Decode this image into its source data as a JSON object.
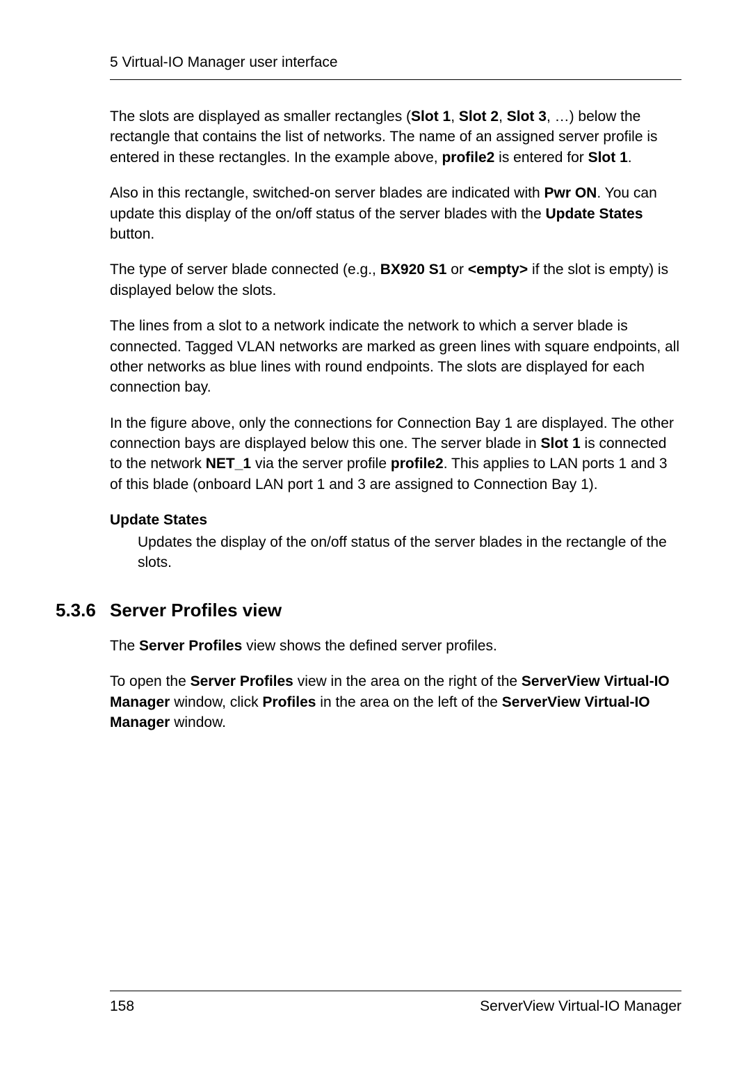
{
  "header": {
    "title": "5 Virtual-IO Manager user interface"
  },
  "content": {
    "p1_a": "The slots are displayed as smaller rectangles (",
    "p1_b": "Slot 1",
    "p1_c": ", ",
    "p1_d": "Slot 2",
    "p1_e": ", ",
    "p1_f": "Slot 3",
    "p1_g": ", …) below the rectangle that contains the list of networks. The name of an assigned server profile is entered in these rectangles. In the example above, ",
    "p1_h": "profile2",
    "p1_i": " is entered for ",
    "p1_j": "Slot 1",
    "p1_k": ".",
    "p2_a": "Also in this rectangle, switched-on server blades are indicated with ",
    "p2_b": "Pwr ON",
    "p2_c": ". You can update this display of the on/off status of the server blades with the ",
    "p2_d": "Update States",
    "p2_e": " button.",
    "p3_a": "The type of server blade connected (e.g., ",
    "p3_b": "BX920 S1",
    "p3_c": "  or ",
    "p3_d": "<empty>",
    "p3_e": " if the slot is empty) is displayed below the slots.",
    "p4": "The lines from a slot to a network indicate the network to which a server blade is connected. Tagged VLAN networks are marked as green lines with square endpoints, all other networks as blue lines with round endpoints. The slots are displayed for each connection bay.",
    "p5_a": "In the figure above, only the connections for Connection Bay 1 are displayed. The other connection bays are displayed below this one. The server blade in ",
    "p5_b": "Slot 1",
    "p5_c": " is connected to the network ",
    "p5_d": "NET_1",
    "p5_e": " via the server profile ",
    "p5_f": "profile2",
    "p5_g": ". This applies to LAN ports 1 and 3 of this blade (onboard LAN port 1 and 3 are assigned to Connection Bay 1).",
    "dl_term": "Update States",
    "dl_def": "Updates the display of the on/off status of the server blades in the rectangle of the slots.",
    "section_num": "5.3.6",
    "section_title": "Server Profiles view",
    "p6_a": "The ",
    "p6_b": "Server Profiles",
    "p6_c": " view shows the defined server profiles.",
    "p7_a": "To open the ",
    "p7_b": "Server Profiles",
    "p7_c": " view in the area on the right of the ",
    "p7_d": "ServerView Virtual-IO Manager",
    "p7_e": " window, click ",
    "p7_f": "Profiles",
    "p7_g": " in the area on the left of the ",
    "p7_h": "ServerView Virtual-IO Manager",
    "p7_i": " window."
  },
  "footer": {
    "page": "158",
    "product": "ServerView Virtual-IO Manager"
  }
}
